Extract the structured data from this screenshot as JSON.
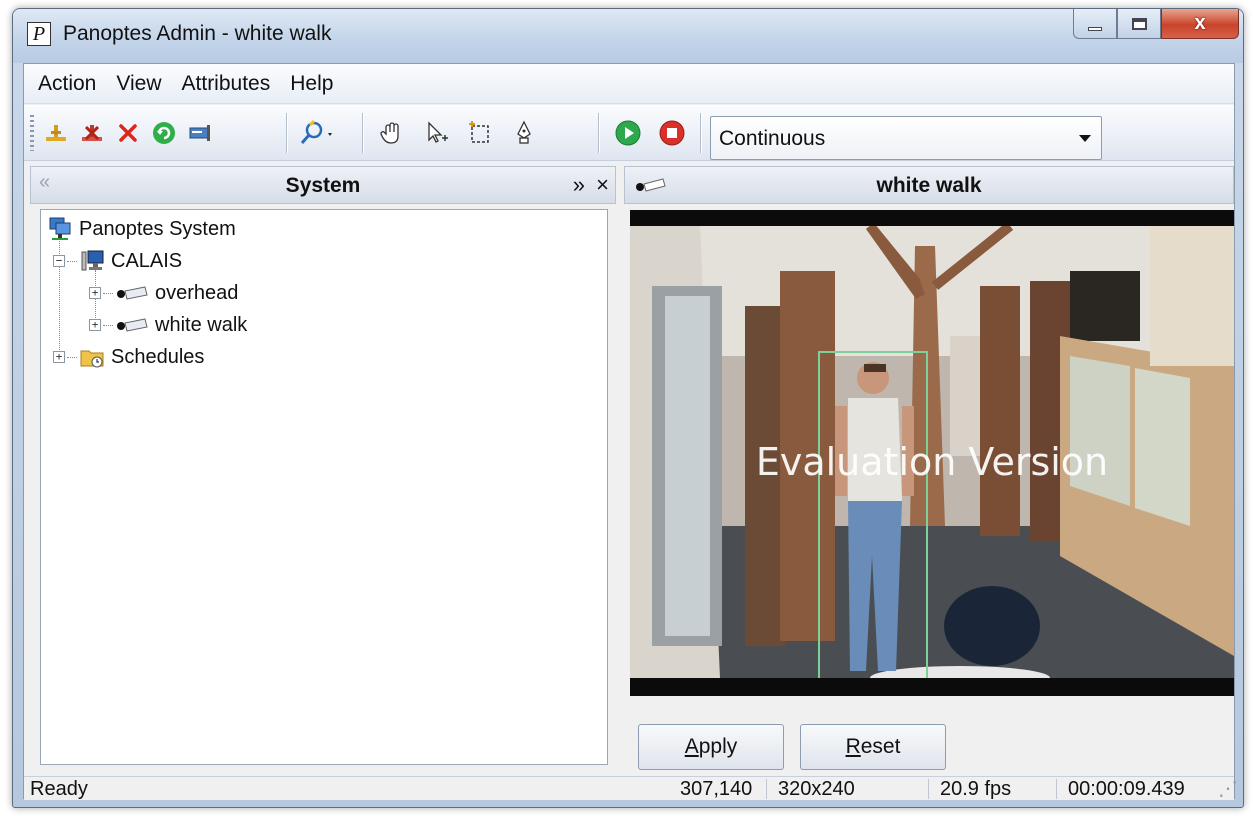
{
  "window": {
    "title": "Panoptes Admin - white walk",
    "app_icon_letter": "P",
    "close_glyph": "x"
  },
  "menu": [
    "Action",
    "View",
    "Attributes",
    "Help"
  ],
  "toolbar": {
    "mode_select_value": "Continuous",
    "buttons": [
      "add-icon",
      "remove-red-icon",
      "delete-x-icon",
      "refresh-icon",
      "properties-icon",
      "zoom-icon",
      "pan-hand-icon",
      "select-arrow-icon",
      "region-select-icon",
      "pen-icon",
      "play-icon",
      "stop-icon"
    ]
  },
  "left_pane": {
    "collapse_glyph": "«",
    "title": "System",
    "expand_glyph": "»",
    "close_glyph": "×",
    "tree": {
      "root": "Panoptes System",
      "node": "CALAIS",
      "cameras": [
        "overhead",
        "white walk"
      ],
      "schedules": "Schedules"
    }
  },
  "right_pane": {
    "title": "white walk",
    "watermark": "Evaluation Version",
    "apply": {
      "prefix": "",
      "underline": "A",
      "rest": "pply"
    },
    "reset": {
      "prefix": "",
      "underline": "R",
      "rest": "eset"
    }
  },
  "status": {
    "state": "Ready",
    "coords": "307,140",
    "resolution": "320x240",
    "fps": "20.9  fps",
    "time": "00:00:09.439"
  },
  "colors": {
    "title_gradient": "#c4d5ea",
    "close_button": "#c8442c",
    "play": "#2da84a",
    "stop": "#d9312a",
    "tracking_box": "#7fcf9a"
  }
}
